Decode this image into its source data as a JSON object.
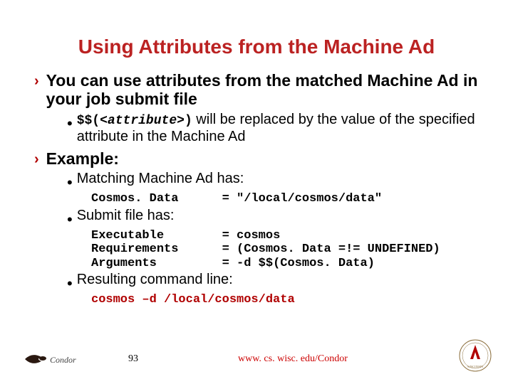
{
  "title": "Using Attributes from the Machine Ad",
  "bullets": {
    "b1a": "You can use attributes from the matched Machine Ad in your job submit file",
    "sub1_pre": "$$(",
    "sub1_mid": "<attribute>",
    "sub1_post": ")",
    "sub1_tail": " will be replaced by the value of the specified attribute in the Machine Ad",
    "b1b": "Example:",
    "sub2": "Matching Machine Ad has:",
    "code1a": "Cosmos. Data",
    "code1b": "= \"/local/cosmos/data\"",
    "sub3": "Submit file has:",
    "code2a": "Executable",
    "code2b": "= cosmos",
    "code2c": "Requirements",
    "code2d": "= (Cosmos. Data =!= UNDEFINED)",
    "code2e": "Arguments",
    "code2f": "= -d $$(Cosmos. Data)",
    "sub4": "Resulting command line:",
    "code3": "cosmos –d /local/cosmos/data"
  },
  "footer": {
    "slidenum": "93",
    "url": "www. cs. wisc. edu/Condor"
  }
}
